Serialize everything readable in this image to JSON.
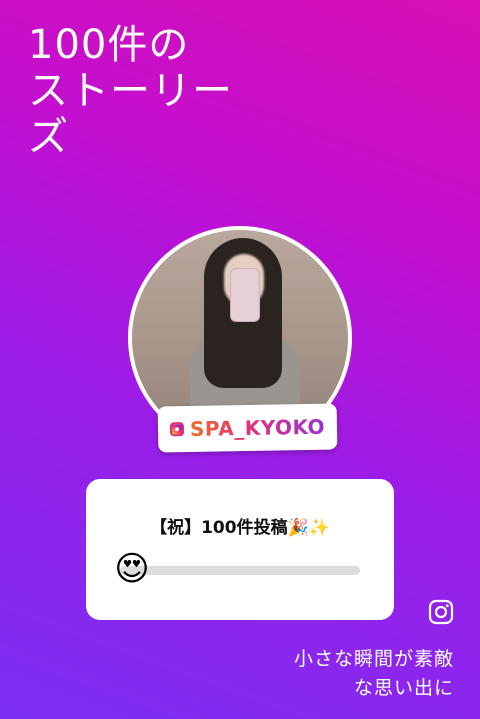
{
  "headline": {
    "line1": "100件の",
    "line2": "ストーリー",
    "line3": "ズ"
  },
  "handle": {
    "text": "SPA_KYOKO",
    "icon": "instagram-icon"
  },
  "slider": {
    "question": "【祝】100件投稿🎉✨",
    "emoji": "😍",
    "value": 0.0
  },
  "caption": {
    "line1": "小さな瞬間が素敵",
    "line2": "な思い出に"
  },
  "colors": {
    "background_top": "#d80fb4",
    "background_bottom": "#7b2ff2",
    "card": "#ffffff",
    "track": "#dcdcdc"
  },
  "icons": [
    "instagram-icon"
  ]
}
